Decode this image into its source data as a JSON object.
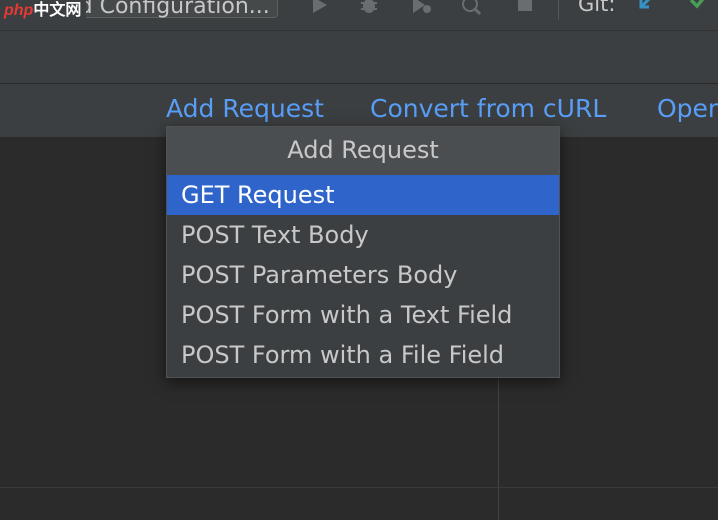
{
  "watermark": {
    "php": "php",
    "cn": "中文网"
  },
  "toolbar": {
    "run_config_label": "Add Configuration...",
    "git_label": "Git:",
    "accent_blue": "#3592c4",
    "accent_green": "#499c54",
    "icons": [
      "run-icon",
      "debug-icon",
      "coverage-icon",
      "profile-icon",
      "stop-icon",
      "git-update-icon",
      "git-commit-icon"
    ]
  },
  "actions": {
    "add_request": "Add Request",
    "convert_curl": "Convert from cURL",
    "open": "Open"
  },
  "popup": {
    "title": "Add Request",
    "items": [
      {
        "label": "GET Request",
        "selected": true
      },
      {
        "label": "POST Text Body",
        "selected": false
      },
      {
        "label": "POST Parameters Body",
        "selected": false
      },
      {
        "label": "POST Form with a Text Field",
        "selected": false
      },
      {
        "label": "POST Form with a File Field",
        "selected": false
      }
    ],
    "selection_color": "#2f65ca"
  }
}
